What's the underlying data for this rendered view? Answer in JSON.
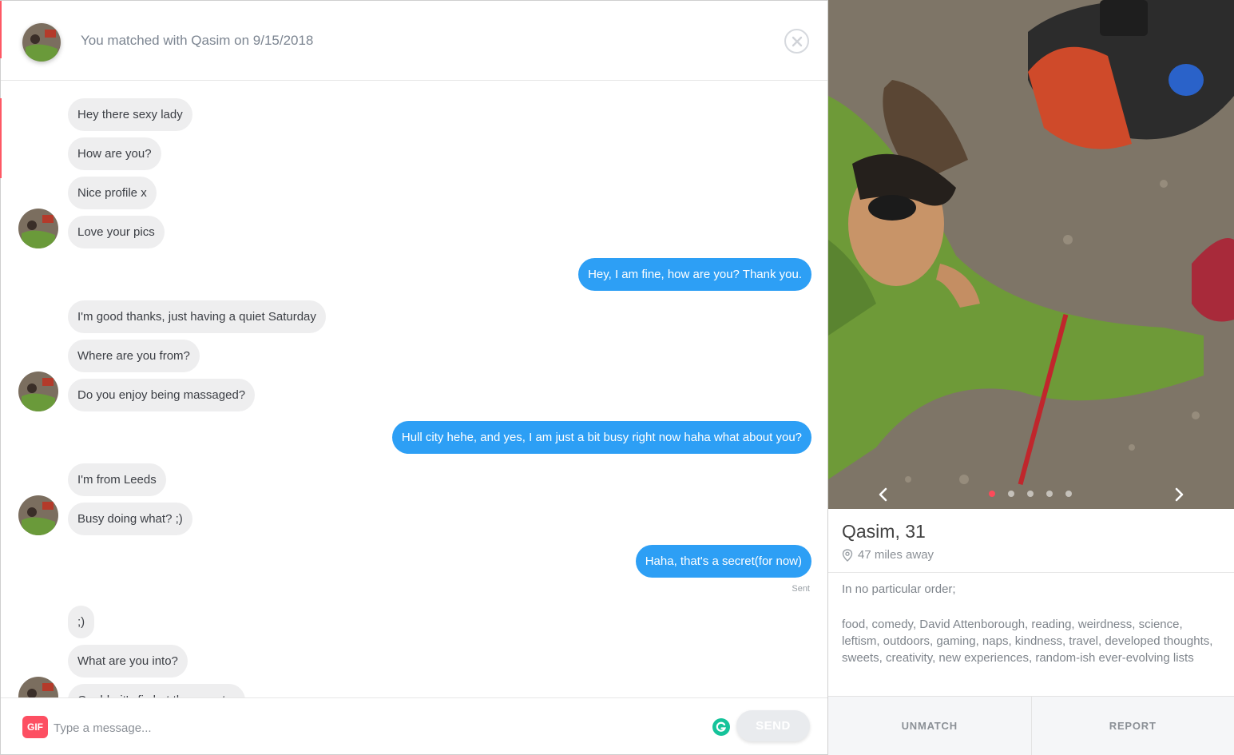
{
  "header": {
    "match_text": "You matched with Qasim on 9/15/2018"
  },
  "messages": {
    "group1": [
      "Hey there sexy lady",
      "How are you?",
      "Nice profile x",
      "Love your pics"
    ],
    "reply1": "Hey, I am fine, how are you? Thank you.",
    "group2": [
      "I'm good thanks, just having a quiet Saturday",
      "Where are you from?",
      "Do you enjoy being massaged?"
    ],
    "reply2": "Hull city hehe, and yes, I am just a bit busy right now haha what about you?",
    "group3": [
      "I'm from Leeds",
      "Busy doing what? ;)"
    ],
    "reply3": "Haha, that's a secret(for now)",
    "reply3_status": "Sent",
    "group4": [
      ";)",
      "What are you into?",
      "Ooohh..it's fix but the secret..."
    ]
  },
  "composer": {
    "gif_label": "GIF",
    "placeholder": "Type a message...",
    "send_label": "SEND"
  },
  "profile": {
    "name_age": "Qasim, 31",
    "distance": "47 miles away",
    "bio_intro": "In no particular order;",
    "bio_interests": "food, comedy, David Attenborough, reading, weirdness, science, leftism, outdoors, gaming, naps, kindness, travel, developed thoughts, sweets, creativity, new experiences, random-ish ever-evolving lists",
    "photo_count": 5,
    "photo_active_index": 1,
    "unmatch_label": "UNMATCH",
    "report_label": "REPORT"
  },
  "colors": {
    "accent": "#fe5864",
    "outgoing_bubble": "#2d9ff5",
    "incoming_bubble": "#eeeeef",
    "gif_badge": "#fd4f62",
    "grammarly": "#15c39a"
  }
}
